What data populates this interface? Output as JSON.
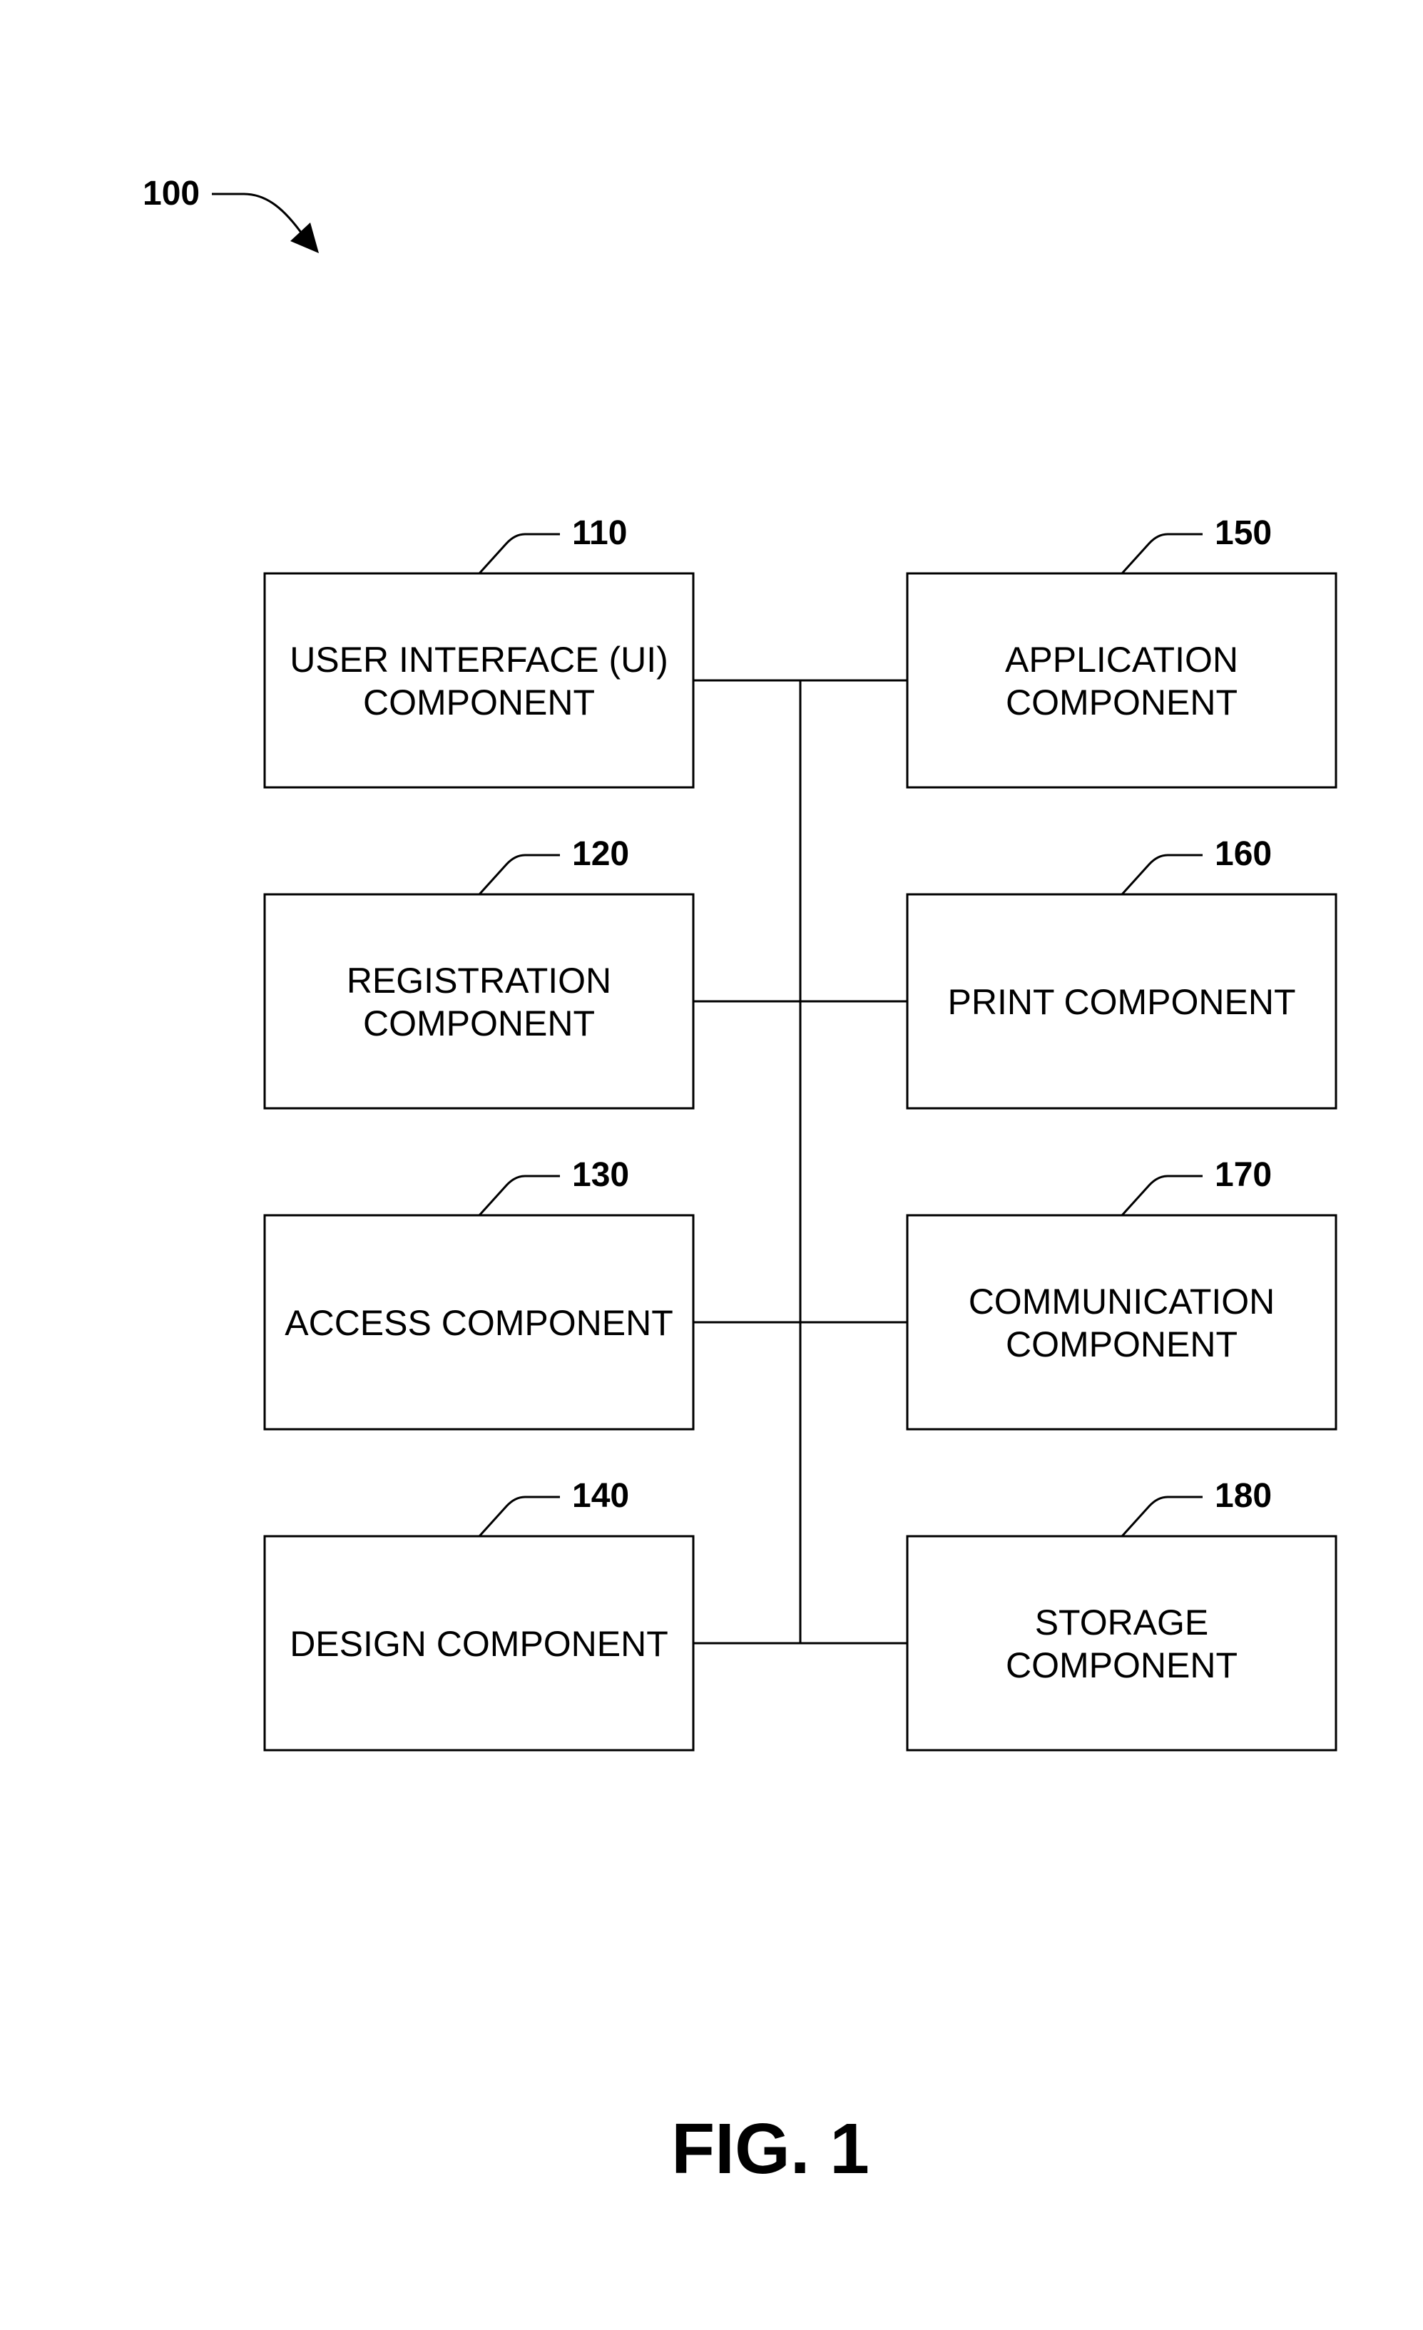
{
  "figure": {
    "reference": "100",
    "caption": "FIG. 1"
  },
  "components": {
    "left": [
      {
        "ref": "110",
        "lines": [
          "USER INTERFACE (UI)",
          "COMPONENT"
        ]
      },
      {
        "ref": "120",
        "lines": [
          "REGISTRATION",
          "COMPONENT"
        ]
      },
      {
        "ref": "130",
        "lines": [
          "ACCESS COMPONENT"
        ]
      },
      {
        "ref": "140",
        "lines": [
          "DESIGN COMPONENT"
        ]
      }
    ],
    "right": [
      {
        "ref": "150",
        "lines": [
          "APPLICATION",
          "COMPONENT"
        ]
      },
      {
        "ref": "160",
        "lines": [
          "PRINT COMPONENT"
        ]
      },
      {
        "ref": "170",
        "lines": [
          "COMMUNICATION",
          "COMPONENT"
        ]
      },
      {
        "ref": "180",
        "lines": [
          "STORAGE",
          "COMPONENT"
        ]
      }
    ]
  },
  "connections": {
    "type": "shared-bus",
    "connects_all_components": true
  },
  "colors": {
    "line": "#000000",
    "background": "#ffffff"
  }
}
